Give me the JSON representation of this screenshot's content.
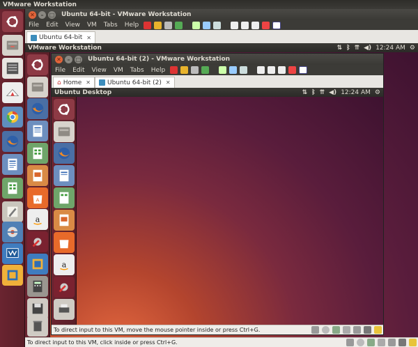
{
  "host": {
    "topbar_title": "VMware Workstation"
  },
  "outer_window": {
    "title": "Ubuntu 64-bit - VMware Workstation",
    "menu": [
      "File",
      "Edit",
      "View",
      "VM",
      "Tabs",
      "Help"
    ],
    "tab_label": "Ubuntu 64-bit",
    "tab_close": "✕",
    "status": "To direct input to this VM, click inside or press Ctrl+G."
  },
  "guest1": {
    "topbar_title": "VMware Workstation",
    "clock": "12:24 AM"
  },
  "inner_window": {
    "title": "Ubuntu 64-bit (2) - VMware Workstation",
    "menu": [
      "File",
      "Edit",
      "View",
      "VM",
      "Tabs",
      "Help"
    ],
    "home_tab": "Home",
    "vm_tab": "Ubuntu 64-bit (2)",
    "tab_close": "✕",
    "status": "To direct input to this VM, move the mouse pointer inside or press Ctrl+G."
  },
  "guest2": {
    "topbar_title": "Ubuntu Desktop",
    "clock": "12:24 AM"
  },
  "icons": {
    "launcher": [
      "ubuntu-dash-icon",
      "files-icon",
      "software-icon",
      "disks-icon",
      "chromium-icon",
      "firefox-icon",
      "writer-icon",
      "calc-icon",
      "text-editor-icon",
      "settings-icon",
      "vmware-icon",
      "vmware-workstation-icon"
    ],
    "indicators": [
      "keyboard-icon",
      "bluetooth-icon",
      "wifi-icon",
      "volume-icon",
      "gear-icon"
    ]
  },
  "colors": {
    "launcher": "#6a2430",
    "panel": "#3c3b37",
    "desktop_orange": "#e4683f",
    "desktop_purple": "#5a1d3c",
    "close_button": "#e0643a"
  }
}
